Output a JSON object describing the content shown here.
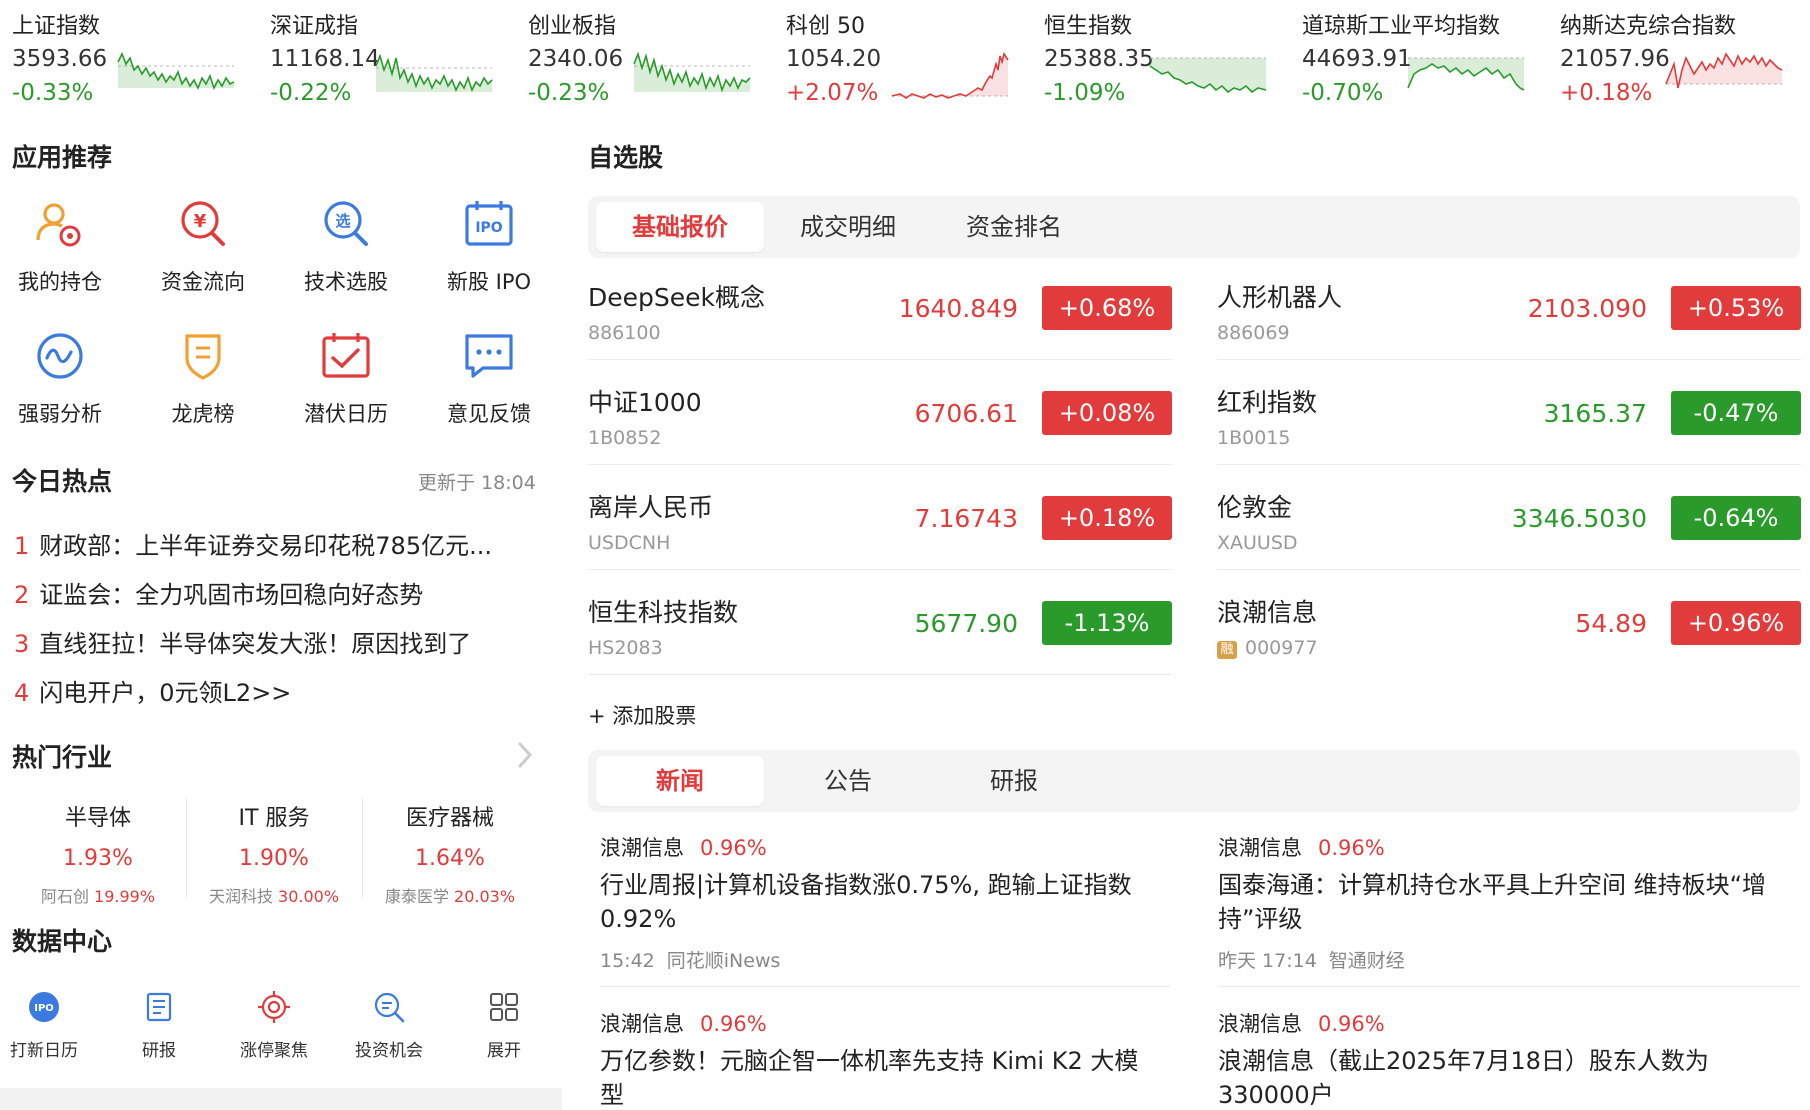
{
  "tickers": [
    {
      "name": "上证指数",
      "value": "3593.66",
      "change": "-0.33%",
      "dir": "down"
    },
    {
      "name": "深证成指",
      "value": "11168.14",
      "change": "-0.22%",
      "dir": "down"
    },
    {
      "name": "创业板指",
      "value": "2340.06",
      "change": "-0.23%",
      "dir": "down"
    },
    {
      "name": "科创 50",
      "value": "1054.20",
      "change": "+2.07%",
      "dir": "up"
    },
    {
      "name": "恒生指数",
      "value": "25388.35",
      "change": "-1.09%",
      "dir": "down"
    },
    {
      "name": "道琼斯工业平均指数",
      "value": "44693.91",
      "change": "-0.70%",
      "dir": "down"
    },
    {
      "name": "纳斯达克综合指数",
      "value": "21057.96",
      "change": "+0.18%",
      "dir": "up"
    }
  ],
  "sections": {
    "apps_title": "应用推荐",
    "hot_title": "今日热点",
    "industry_title": "热门行业",
    "data_center_title": "数据中心",
    "watchlist_title": "自选股"
  },
  "apps": [
    {
      "label": "我的持仓",
      "icon": "portfolio-icon"
    },
    {
      "label": "资金流向",
      "icon": "money-flow-icon"
    },
    {
      "label": "技术选股",
      "icon": "stock-screener-icon"
    },
    {
      "label": "新股 IPO",
      "icon": "ipo-calendar-icon"
    },
    {
      "label": "强弱分析",
      "icon": "strength-analysis-icon"
    },
    {
      "label": "龙虎榜",
      "icon": "dragon-tiger-icon"
    },
    {
      "label": "潜伏日历",
      "icon": "calendar-check-icon"
    },
    {
      "label": "意见反馈",
      "icon": "feedback-icon"
    }
  ],
  "hot": {
    "updated": "更新于 18:04",
    "items": [
      {
        "num": "1",
        "text": "财政部：上半年证券交易印花税785亿元..."
      },
      {
        "num": "2",
        "text": "证监会：全力巩固市场回稳向好态势"
      },
      {
        "num": "3",
        "text": "直线狂拉！半导体突发大涨！原因找到了"
      },
      {
        "num": "4",
        "text": "闪电开户，0元领L2>>"
      }
    ]
  },
  "industries": [
    {
      "name": "半导体",
      "pct": "1.93%",
      "stock": "阿石创",
      "stock_pct": "19.99%"
    },
    {
      "name": "IT 服务",
      "pct": "1.90%",
      "stock": "天润科技",
      "stock_pct": "30.00%"
    },
    {
      "name": "医疗器械",
      "pct": "1.64%",
      "stock": "康泰医学",
      "stock_pct": "20.03%"
    }
  ],
  "data_center": [
    {
      "label": "打新日历",
      "icon": "ipo-badge-icon"
    },
    {
      "label": "研报",
      "icon": "report-icon"
    },
    {
      "label": "涨停聚焦",
      "icon": "target-icon"
    },
    {
      "label": "投资机会",
      "icon": "search-opportunity-icon"
    },
    {
      "label": "展开",
      "icon": "grid-icon"
    }
  ],
  "watch_tabs": [
    "基础报价",
    "成交明细",
    "资金排名"
  ],
  "stocks": [
    {
      "name": "DeepSeek概念",
      "code": "886100",
      "price": "1640.849",
      "change": "+0.68%",
      "dir": "up"
    },
    {
      "name": "人形机器人",
      "code": "886069",
      "price": "2103.090",
      "change": "+0.53%",
      "dir": "up"
    },
    {
      "name": "中证1000",
      "code": "1B0852",
      "price": "6706.61",
      "change": "+0.08%",
      "dir": "up"
    },
    {
      "name": "红利指数",
      "code": "1B0015",
      "price": "3165.37",
      "change": "-0.47%",
      "dir": "down"
    },
    {
      "name": "离岸人民币",
      "code": "USDCNH",
      "price": "7.16743",
      "change": "+0.18%",
      "dir": "up"
    },
    {
      "name": "伦敦金",
      "code": "XAUUSD",
      "price": "3346.5030",
      "change": "-0.64%",
      "dir": "down"
    },
    {
      "name": "恒生科技指数",
      "code": "HS2083",
      "price": "5677.90",
      "change": "-1.13%",
      "dir": "down"
    },
    {
      "name": "浪潮信息",
      "code": "000977",
      "price": "54.89",
      "change": "+0.96%",
      "dir": "up",
      "margin_tag": "融"
    }
  ],
  "add_stock": "+ 添加股票",
  "news_tabs": [
    "新闻",
    "公告",
    "研报"
  ],
  "news": [
    {
      "stock": "浪潮信息",
      "pct": "0.96%",
      "title": "行业周报|计算机设备指数涨0.75%, 跑输上证指数0.92%",
      "time": "15:42",
      "source": "同花顺iNews"
    },
    {
      "stock": "浪潮信息",
      "pct": "0.96%",
      "title": "国泰海通：计算机持仓水平具上升空间 维持板块“增持”评级",
      "time": "昨天 17:14",
      "source": "智通财经"
    },
    {
      "stock": "浪潮信息",
      "pct": "0.96%",
      "title": "万亿参数！元脑企智一体机率先支持 Kimi K2 大模型",
      "time": "",
      "source": ""
    },
    {
      "stock": "浪潮信息",
      "pct": "0.96%",
      "title": "浪潮信息（截止2025年7月18日）股东人数为330000户",
      "time": "",
      "source": ""
    }
  ],
  "colors": {
    "up": "#e23b3b",
    "down": "#2a9b2a",
    "accent": "#e23b3b",
    "icon_blue": "#3b7be0",
    "icon_orange": "#f0a030"
  }
}
